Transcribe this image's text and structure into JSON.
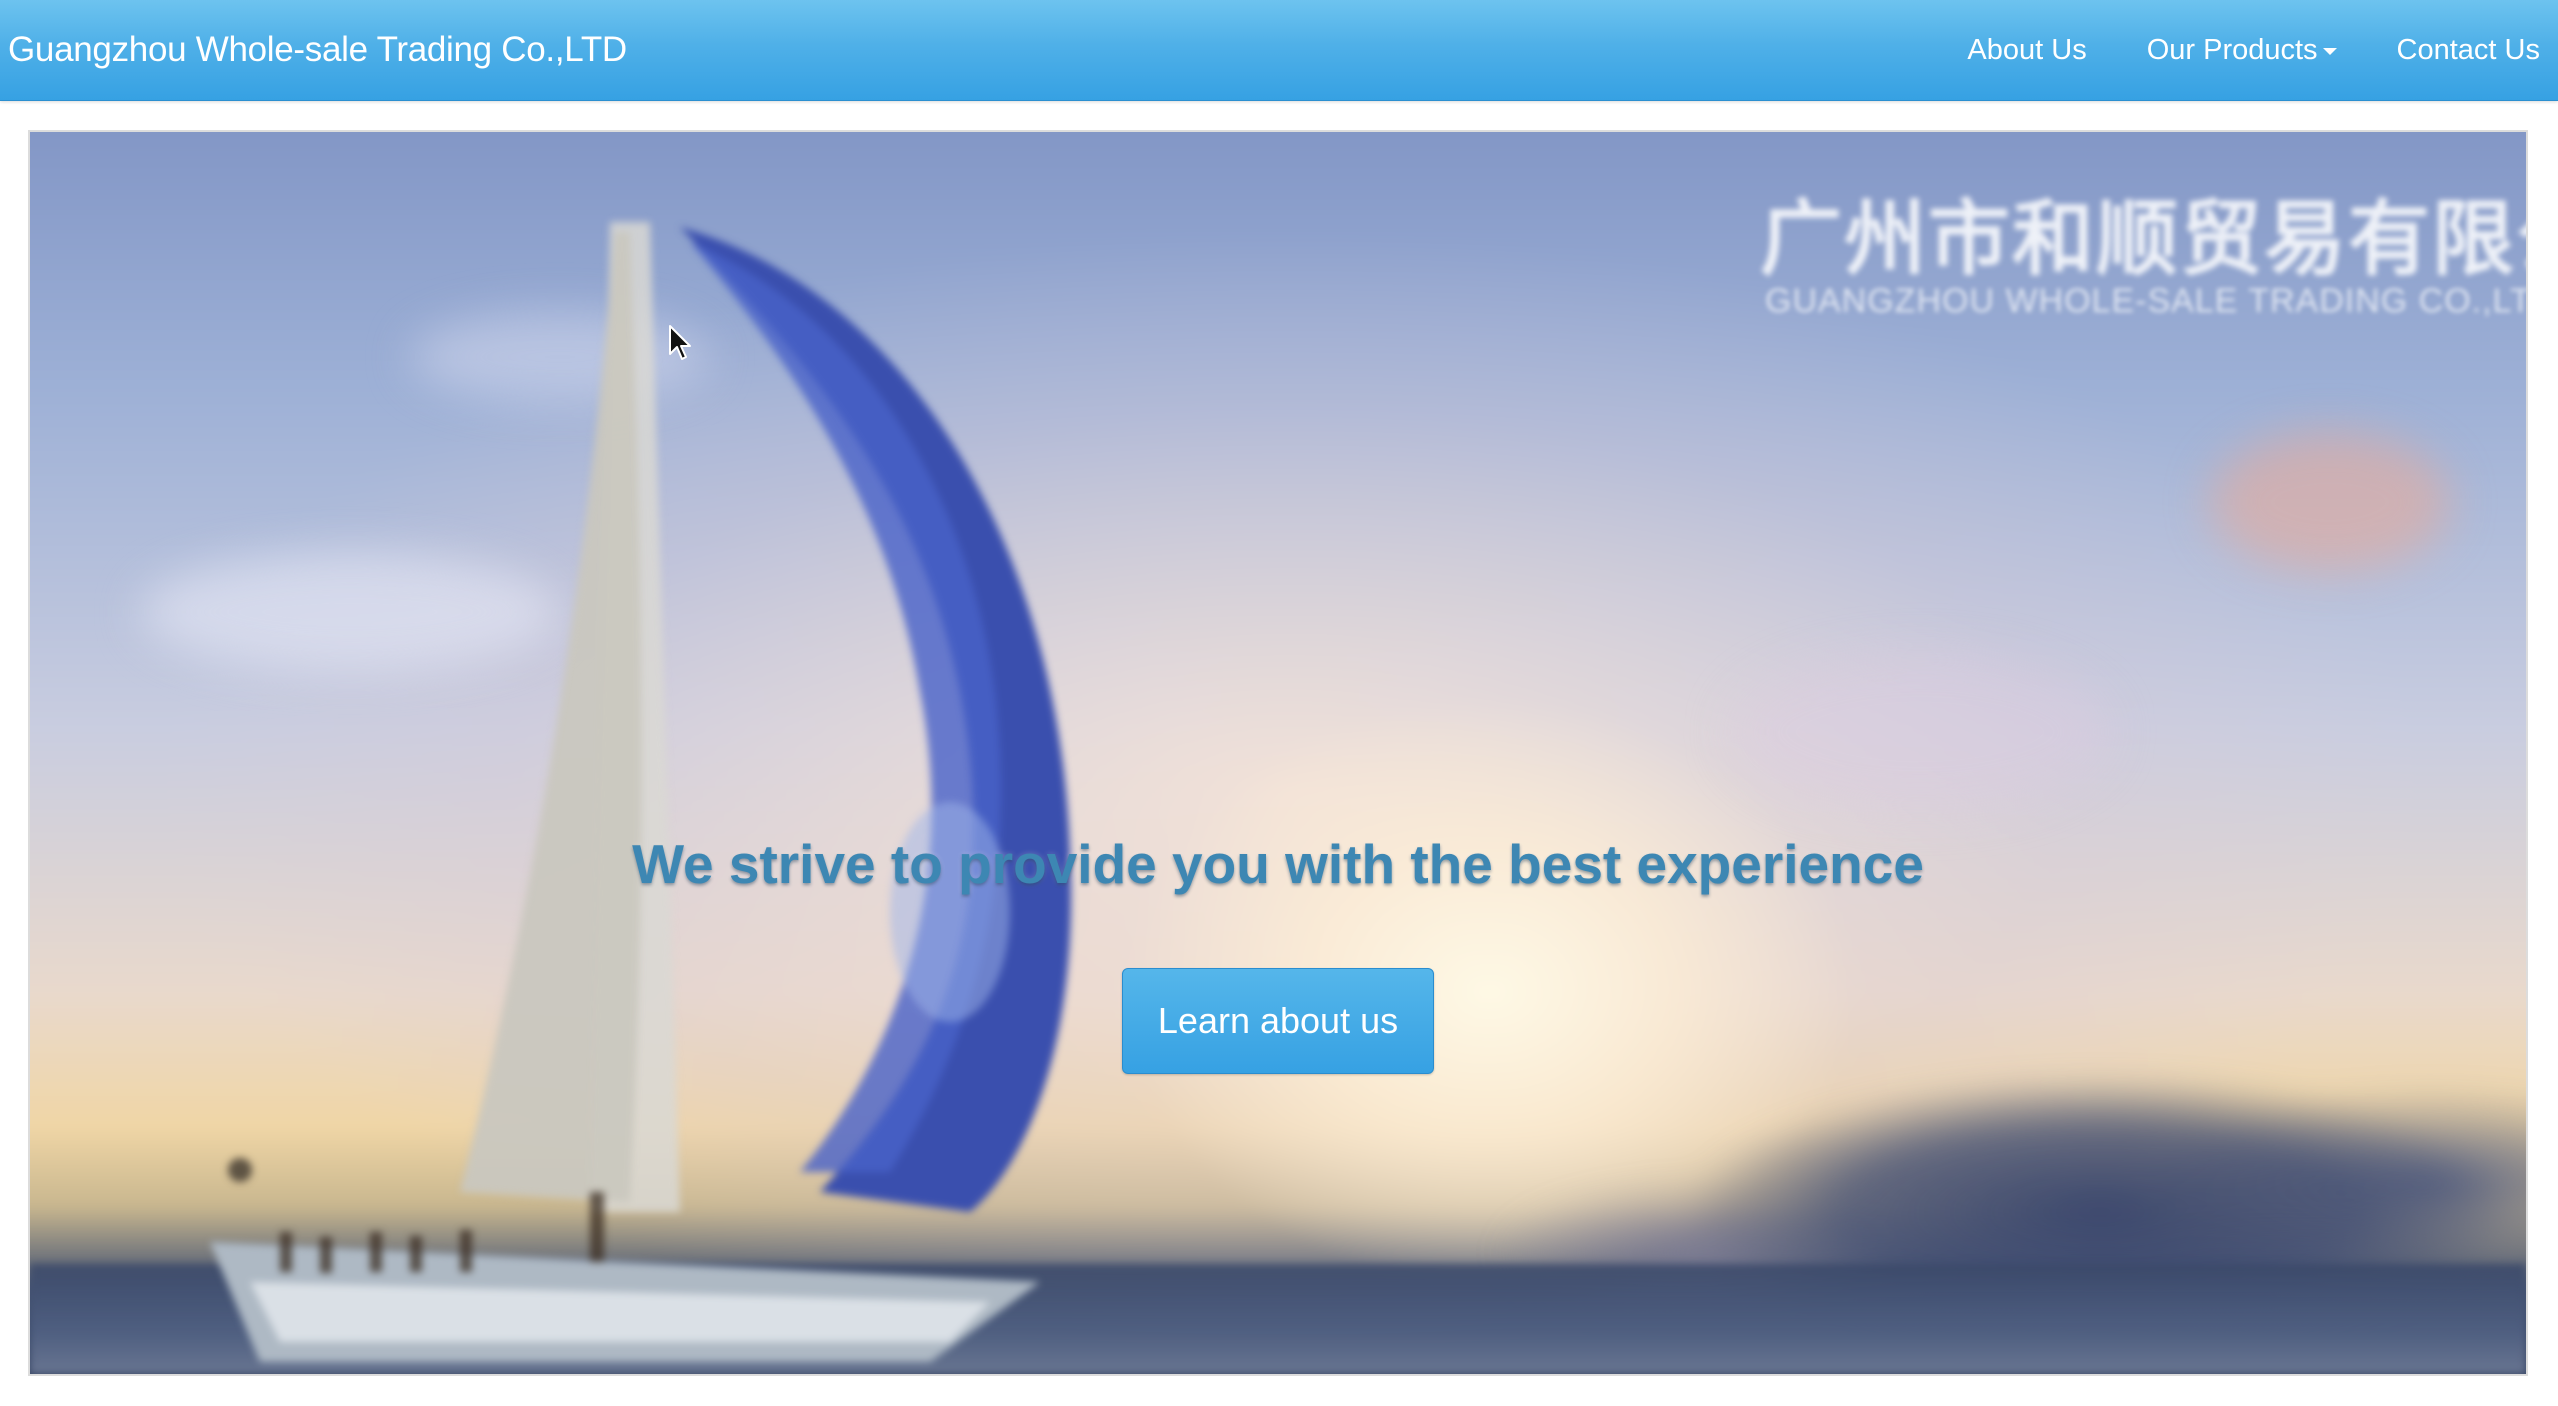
{
  "navbar": {
    "brand": "Guangzhou Whole-sale Trading Co.,LTD",
    "items": [
      {
        "label": "About Us"
      },
      {
        "label": "Our Products",
        "has_dropdown": true
      },
      {
        "label": "Contact Us"
      }
    ],
    "color": "#3aa4e4"
  },
  "hero": {
    "watermark_cn": "广州市和顺贸易有限公司",
    "watermark_en": "GUANGZHOU WHOLE-SALE TRADING CO.,LTD",
    "headline": "We strive to provide you with the best experience",
    "cta_label": "Learn about us",
    "cta_color": "#36a1e3",
    "headline_color": "#3d87b3"
  }
}
